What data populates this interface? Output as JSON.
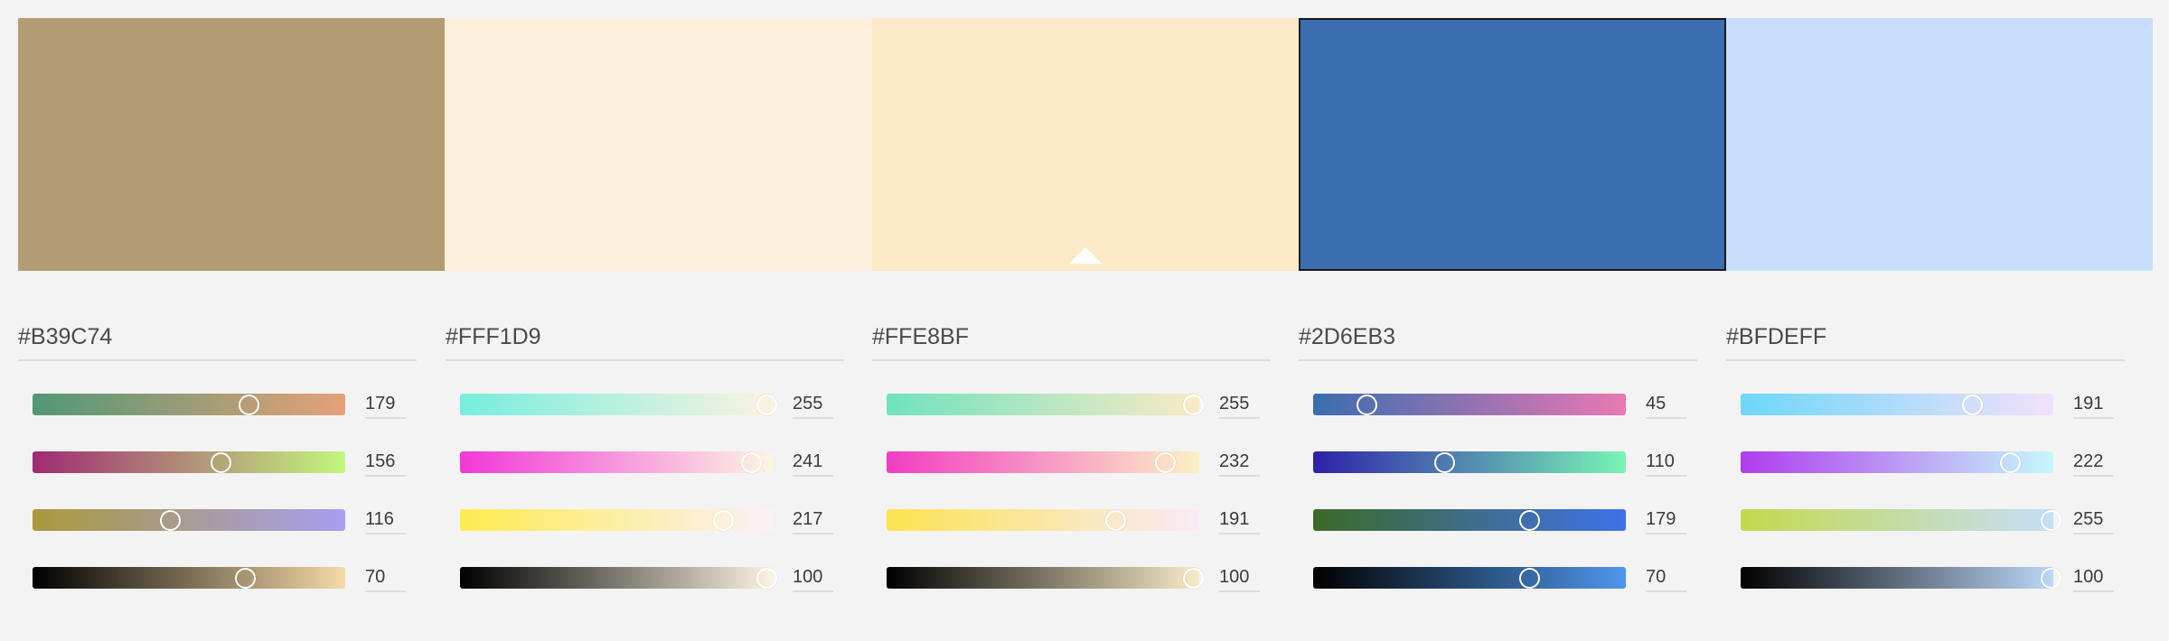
{
  "swatches": [
    {
      "color": "#B39C74",
      "selected": false,
      "marker": false
    },
    {
      "color": "#FDF1DE",
      "selected": false,
      "marker": false
    },
    {
      "color": "#FBE9C7",
      "selected": false,
      "marker": true
    },
    {
      "color": "#3B6DB1",
      "selected": true,
      "marker": false
    },
    {
      "color": "#C6DEFB",
      "selected": false,
      "marker": false
    }
  ],
  "panels": [
    {
      "hex": "#B39C74",
      "sliders": [
        {
          "channel": "red",
          "value": "179",
          "level": 0.69,
          "gradient": [
            "#509876",
            "#E6A178"
          ]
        },
        {
          "channel": "green",
          "value": "156",
          "level": 0.6,
          "gradient": [
            "#A02A73",
            "#C3F77C"
          ]
        },
        {
          "channel": "blue",
          "value": "116",
          "level": 0.44,
          "gradient": [
            "#AA993A",
            "#A79EF2"
          ]
        },
        {
          "channel": "alpha",
          "value": "70",
          "level": 0.68,
          "gradient": [
            "#000000",
            "#F6DAA8"
          ]
        }
      ]
    },
    {
      "hex": "#FFF1D9",
      "sliders": [
        {
          "channel": "red",
          "value": "255",
          "level": 0.98,
          "gradient": [
            "#76EEDD",
            "#FCF2E0"
          ]
        },
        {
          "channel": "green",
          "value": "241",
          "level": 0.93,
          "gradient": [
            "#F138D8",
            "#FDF5E2"
          ]
        },
        {
          "channel": "blue",
          "value": "217",
          "level": 0.84,
          "gradient": [
            "#FDEB4F",
            "#FBF1F8"
          ]
        },
        {
          "channel": "alpha",
          "value": "100",
          "level": 0.98,
          "gradient": [
            "#000000",
            "#FBF2E1"
          ]
        }
      ]
    },
    {
      "hex": "#FFE8BF",
      "sliders": [
        {
          "channel": "red",
          "value": "255",
          "level": 0.98,
          "gradient": [
            "#6FE3BD",
            "#FAEAC5"
          ]
        },
        {
          "channel": "green",
          "value": "232",
          "level": 0.89,
          "gradient": [
            "#F23DC2",
            "#FCF0C5"
          ]
        },
        {
          "channel": "blue",
          "value": "191",
          "level": 0.73,
          "gradient": [
            "#FBE350",
            "#F9EAF9"
          ]
        },
        {
          "channel": "alpha",
          "value": "100",
          "level": 0.98,
          "gradient": [
            "#000000",
            "#F8EBC8"
          ]
        }
      ]
    },
    {
      "hex": "#2D6EB3",
      "sliders": [
        {
          "channel": "red",
          "value": "45",
          "level": 0.17,
          "gradient": [
            "#3A6DB0",
            "#EA78B2"
          ]
        },
        {
          "channel": "green",
          "value": "110",
          "level": 0.42,
          "gradient": [
            "#2D21AA",
            "#79F5B6"
          ]
        },
        {
          "channel": "blue",
          "value": "179",
          "level": 0.69,
          "gradient": [
            "#3B6A27",
            "#3F71EA"
          ]
        },
        {
          "channel": "alpha",
          "value": "70",
          "level": 0.69,
          "gradient": [
            "#000000",
            "#4E97EC"
          ]
        }
      ]
    },
    {
      "hex": "#BFDEFF",
      "sliders": [
        {
          "channel": "red",
          "value": "191",
          "level": 0.74,
          "gradient": [
            "#6DD7F8",
            "#F3E0FB"
          ]
        },
        {
          "channel": "green",
          "value": "222",
          "level": 0.86,
          "gradient": [
            "#B03CEE",
            "#C5F8FB"
          ]
        },
        {
          "channel": "blue",
          "value": "255",
          "level": 0.99,
          "gradient": [
            "#C3DA4C",
            "#C4DEF9"
          ]
        },
        {
          "channel": "alpha",
          "value": "100",
          "level": 0.99,
          "gradient": [
            "#000000",
            "#BCD7F8"
          ]
        }
      ]
    }
  ]
}
